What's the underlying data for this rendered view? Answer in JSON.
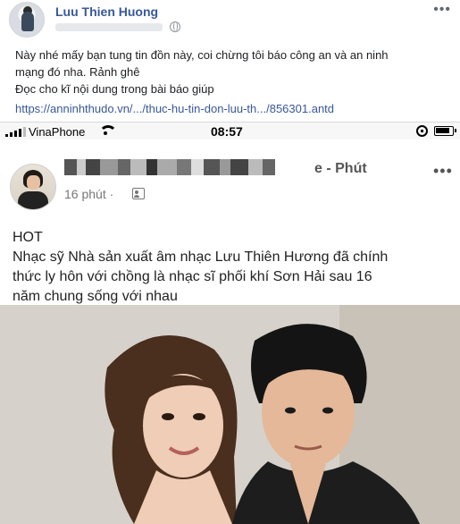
{
  "outer_post": {
    "author": "Luu Thien Huong",
    "more_label": "•••",
    "text_lines": [
      "Này nhé mấy bạn tung tin đồn này, coi chừng tôi báo công an và an ninh",
      "mạng đó nha. Rảnh ghê",
      "Đọc cho kĩ nội dung trong bài báo giúp"
    ],
    "link": "https://anninhthudo.vn/.../thuc-hu-tin-don-luu-th.../856301.antd"
  },
  "phone": {
    "carrier": "VinaPhone",
    "time": "08:57",
    "inner_post": {
      "name_tail": "e - Phút",
      "time": "16 phút",
      "dot": "·",
      "more_label": "•••",
      "text_lines": [
        "HOT",
        " Nhạc sỹ Nhà sản xuất âm nhạc Lưu Thiên Hương đã chính",
        "thức  ly hôn với chồng  là nhạc sĩ phối khí Sơn Hải sau 16",
        "năm chung sống với nhau"
      ]
    }
  },
  "colors": {
    "link_blue": "#385898",
    "text_dark": "#1c1e21",
    "meta_gray": "#777777"
  }
}
